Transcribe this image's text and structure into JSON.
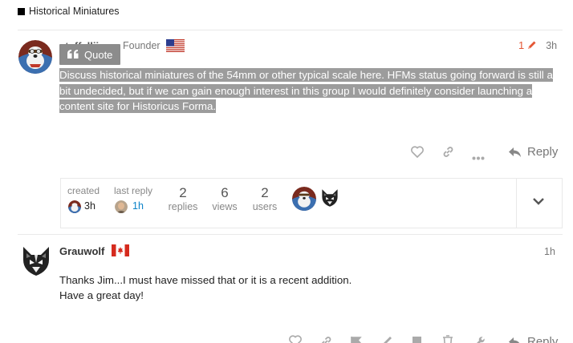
{
  "breadcrumb": {
    "category": "Historical Miniatures"
  },
  "post1": {
    "username": "staffelljim",
    "role": "Founder",
    "flag": "United States",
    "edit_count": "1",
    "time": "3h",
    "quote_label": "Quote",
    "body_lines": [
      "Discuss historical miniatures of the 54mm or other typical scale here. HFMs status going forward is still a",
      "bit undecided, but if we can gain enough interest in this group I would definitely consider launching a",
      "content site for Historicus Forma."
    ],
    "reply_label": "Reply"
  },
  "topic_map": {
    "created_label": "created",
    "created_time": "3h",
    "last_reply_label": "last reply",
    "last_reply_time": "1h",
    "replies_count": "2",
    "replies_label": "replies",
    "views_count": "6",
    "views_label": "views",
    "users_count": "2",
    "users_label": "users"
  },
  "post2": {
    "username": "Grauwolf",
    "flag": "Canada",
    "time": "1h",
    "body_lines": [
      "Thanks Jim...I must have missed that or it is a recent addition.",
      "Have a great day!"
    ],
    "reply_label": "Reply"
  },
  "colors": {
    "accent": "#e45735",
    "link": "#0a82c8",
    "selection": "#9c9c9c",
    "quote_button": "#8c8c8c"
  },
  "icons": [
    "quote-icon",
    "pencil-icon",
    "heart-icon",
    "link-icon",
    "ellipsis-icon",
    "reply-icon",
    "chevron-down-icon",
    "flag-icon",
    "bookmark-icon",
    "trash-icon",
    "wrench-icon"
  ]
}
